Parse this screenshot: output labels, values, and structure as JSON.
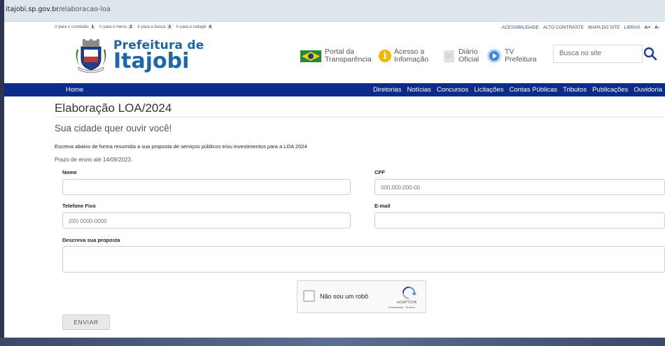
{
  "browser": {
    "url_host": "itajobi.sp.gov.br",
    "url_path": "/elaboracao-loa"
  },
  "skiplinks": [
    {
      "label": "Ir para o conteúdo",
      "key": "1"
    },
    {
      "label": "Ir para o menu",
      "key": "2"
    },
    {
      "label": "Ir para a busca",
      "key": "3"
    },
    {
      "label": "Ir para o rodapé",
      "key": "4"
    }
  ],
  "accessibility": [
    "ACESSIBILIDADE",
    "ALTO CONTRASTE",
    "MAPA DO SITE",
    "LIBRAS",
    "A+",
    "A-"
  ],
  "logo": {
    "line1": "Prefeitura de",
    "line2": "Itajobi"
  },
  "quicklinks": [
    {
      "l1": "Portal da",
      "l2": "Transparência"
    },
    {
      "l1": "Acesso a",
      "l2": "Infomação"
    },
    {
      "l1": "Diário",
      "l2": "Oficial"
    },
    {
      "l1": "TV",
      "l2": "Prefeitura"
    }
  ],
  "search": {
    "placeholder": "Busca no site"
  },
  "nav": {
    "home": "Home",
    "items": [
      "Diretorias",
      "Notícias",
      "Concursos",
      "Licitações",
      "Contas Públicas",
      "Tributos",
      "Publicações",
      "Ouvidoria"
    ]
  },
  "content": {
    "title": "Elaboração LOA/2024",
    "subtitle": "Sua cidade quer ouvir você!",
    "intro": "Escreva abaixo de forma resumida a sua proposta de serviços públicos e/ou investimentos para a LOA 2024",
    "deadline": "Prazo de envio até 14/09/2023."
  },
  "form": {
    "nome_label": "Nome",
    "nome_value": "",
    "cpf_label": "CPF",
    "cpf_placeholder": "000.000.000-00",
    "telefone_label": "Telefone Fixo",
    "telefone_placeholder": "(00) 0000-0000",
    "email_label": "E-mail",
    "email_value": "",
    "proposta_label": "Descreva sua proposta",
    "proposta_value": "",
    "recaptcha_text": "Não sou um robô",
    "recaptcha_brand": "reCAPTCHA",
    "recaptcha_terms": "Privacidade - Termos",
    "submit_label": "ENVIAR"
  },
  "colors": {
    "nav_bg": "#0b2c8a",
    "logo": "#1d67a8"
  }
}
